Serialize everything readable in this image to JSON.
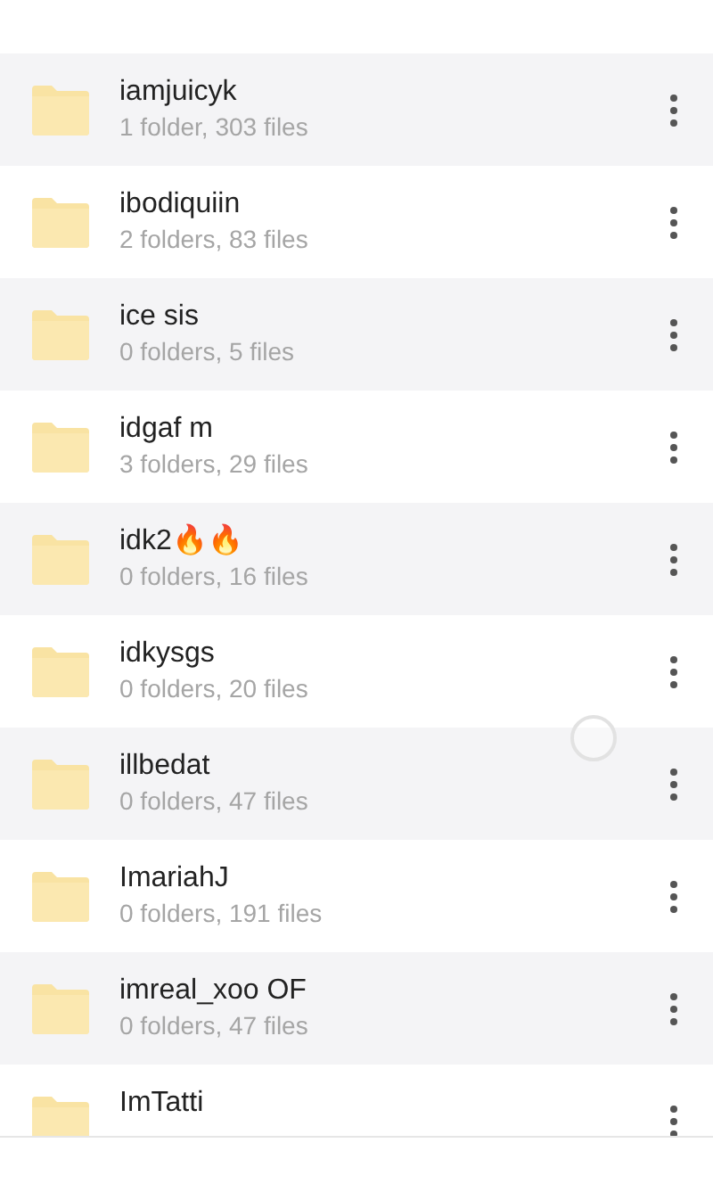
{
  "folders": [
    {
      "name": "iamjuicyk",
      "details": "1 folder, 303 files"
    },
    {
      "name": "ibodiquiin",
      "details": "2 folders, 83 files"
    },
    {
      "name": "ice sis",
      "details": "0 folders, 5 files"
    },
    {
      "name": "idgaf m",
      "details": "3 folders, 29 files"
    },
    {
      "name": "idk2🔥🔥",
      "details": "0 folders, 16 files"
    },
    {
      "name": "idkysgs",
      "details": "0 folders, 20 files"
    },
    {
      "name": "illbedat",
      "details": "0 folders, 47 files"
    },
    {
      "name": "ImariahJ",
      "details": "0 folders, 191 files"
    },
    {
      "name": "imreal_xoo OF",
      "details": "0 folders, 47 files"
    },
    {
      "name": "ImTatti"
    }
  ]
}
